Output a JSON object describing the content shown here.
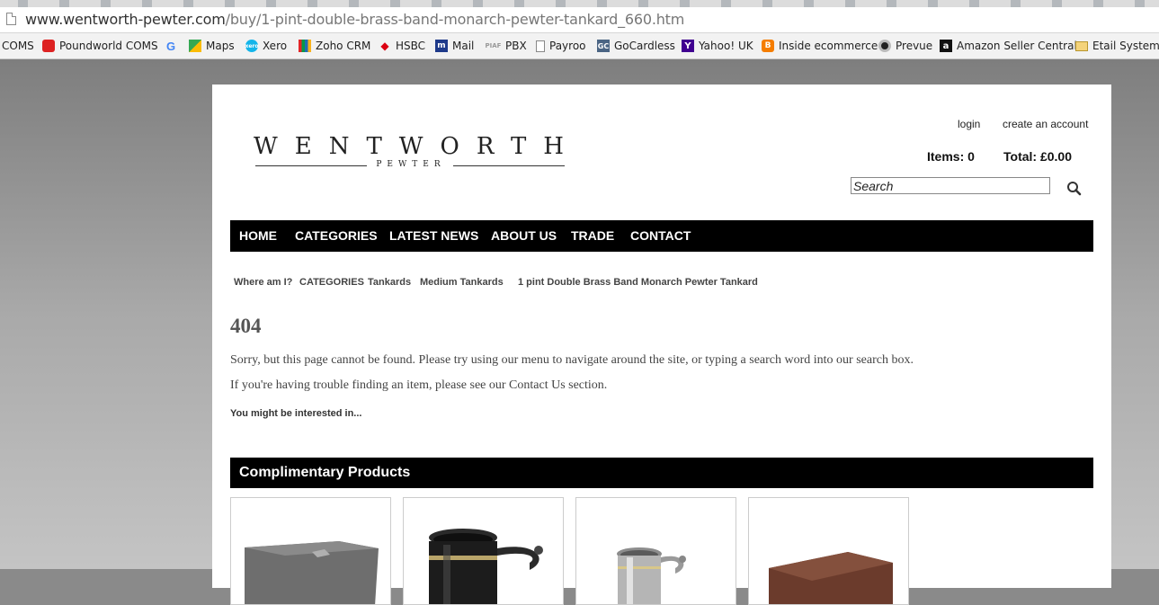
{
  "browser": {
    "url_host": "www.wentworth-pewter.com",
    "url_path": "/buy/1-pint-double-brass-band-monarch-pewter-tankard_660.htm"
  },
  "bookmarks": [
    {
      "label": "COMS",
      "icon": "none"
    },
    {
      "label": "Poundworld COMS",
      "icon": "red-square-icon"
    },
    {
      "label": "",
      "icon": "google-icon"
    },
    {
      "label": "Maps",
      "icon": "maps-icon"
    },
    {
      "label": "Xero",
      "icon": "xero-icon"
    },
    {
      "label": "Zoho CRM",
      "icon": "zoho-icon"
    },
    {
      "label": "HSBC",
      "icon": "hsbc-icon"
    },
    {
      "label": "Mail",
      "icon": "mail-icon"
    },
    {
      "label": "PBX",
      "icon": "pbx-icon"
    },
    {
      "label": "Payroo",
      "icon": "page-icon"
    },
    {
      "label": "GoCardless",
      "icon": "gocardless-icon"
    },
    {
      "label": "Yahoo! UK",
      "icon": "yahoo-icon"
    },
    {
      "label": "Inside ecommerce",
      "icon": "blogger-icon"
    },
    {
      "label": "Prevue",
      "icon": "prevue-icon"
    },
    {
      "label": "Amazon Seller Central",
      "icon": "amazon-icon"
    },
    {
      "label": "Etail Systems",
      "icon": "folder-icon"
    }
  ],
  "header": {
    "logo_word": "WENTWORTH",
    "logo_sub": "PEWTER",
    "login": "login",
    "create_account": "create an account",
    "items": "Items: 0",
    "total": "Total: £0.00",
    "search_placeholder": "Search"
  },
  "nav": [
    "HOME",
    "CATEGORIES",
    "LATEST NEWS",
    "ABOUT US",
    "TRADE",
    "CONTACT"
  ],
  "breadcrumb": [
    "Where am I?",
    "CATEGORIES",
    "Tankards",
    "Medium Tankards",
    "1 pint Double Brass Band Monarch Pewter Tankard"
  ],
  "main": {
    "heading": "404",
    "line1": "Sorry, but this page cannot be found. Please try using our menu to navigate around the site, or typing a search word into our search box.",
    "line2": "If you're having trouble finding an item, please see our Contact Us section.",
    "interested": "You might be interested in..."
  },
  "complimentary": {
    "title": "Complimentary Products",
    "products": [
      "grey-gift-box-image",
      "black-tankard-image",
      "silver-tankard-image",
      "brown-gift-box-image"
    ]
  }
}
